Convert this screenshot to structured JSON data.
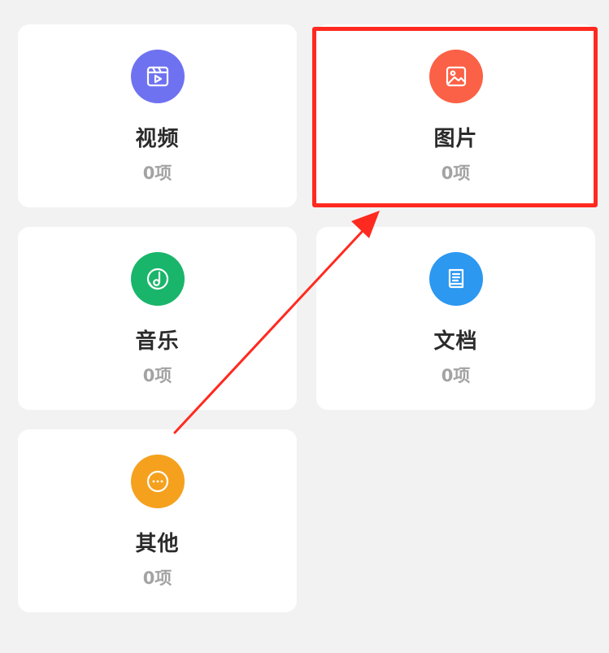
{
  "categories": [
    {
      "key": "video",
      "title": "视频",
      "count": "0项",
      "icon": "video-icon",
      "color": "#6f72f0"
    },
    {
      "key": "image",
      "title": "图片",
      "count": "0项",
      "icon": "image-icon",
      "color": "#fb6146"
    },
    {
      "key": "music",
      "title": "音乐",
      "count": "0项",
      "icon": "music-icon",
      "color": "#19b56a"
    },
    {
      "key": "document",
      "title": "文档",
      "count": "0项",
      "icon": "document-icon",
      "color": "#2c98f0"
    },
    {
      "key": "other",
      "title": "其他",
      "count": "0项",
      "icon": "more-icon",
      "color": "#f5a11e"
    }
  ],
  "annotation": {
    "color": "#ff2a1f"
  }
}
